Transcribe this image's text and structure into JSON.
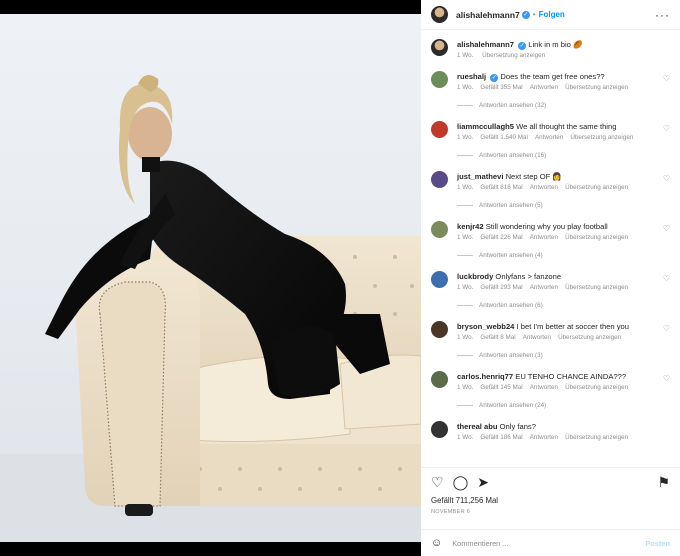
{
  "post": {
    "username": "alishalehmann7",
    "follow_label": "Folgen",
    "caption": "Link in m bio",
    "caption_time": "1 Wo.",
    "caption_translate": "Übersetzung anzeigen"
  },
  "comments": [
    {
      "user": "rueshalj",
      "verified": true,
      "text": "Does the team get free ones??",
      "time": "1 Wo.",
      "likes": "Gefällt 355 Mal",
      "reply": "Antworten",
      "translate": "Übersetzung anzeigen",
      "replies": "Antworten ansehen (32)",
      "color": "#6b8e5a"
    },
    {
      "user": "liammccullagh5",
      "verified": false,
      "text": "We all thought the same thing",
      "time": "1 Wo.",
      "likes": "Gefällt 1.540 Mal",
      "reply": "Antworten",
      "translate": "Übersetzung anzeigen",
      "replies": "Antworten ansehen (16)",
      "color": "#c0392b"
    },
    {
      "user": "just_mathevi",
      "verified": false,
      "text": "Next step OF 👩",
      "time": "1 Wo.",
      "likes": "Gefällt 818 Mal",
      "reply": "Antworten",
      "translate": "Übersetzung anzeigen",
      "replies": "Antworten ansehen (5)",
      "color": "#5b4a8a"
    },
    {
      "user": "kenjr42",
      "verified": false,
      "text": "Still wondering why you play football",
      "time": "1 Wo.",
      "likes": "Gefällt 226 Mal",
      "reply": "Antworten",
      "translate": "Übersetzung anzeigen",
      "replies": "Antworten ansehen (4)",
      "color": "#7a8c5c"
    },
    {
      "user": "luckbrody",
      "verified": false,
      "text": "Onlyfans > fanzone",
      "time": "1 Wo.",
      "likes": "Gefällt 293 Mal",
      "reply": "Antworten",
      "translate": "Übersetzung anzeigen",
      "replies": "Antworten ansehen (6)",
      "color": "#3d6fb0"
    },
    {
      "user": "bryson_webb24",
      "verified": false,
      "text": "I bet I'm better at soccer then you",
      "time": "1 Wo.",
      "likes": "Gefällt 8 Mal",
      "reply": "Antworten",
      "translate": "Übersetzung anzeigen",
      "replies": "Antworten ansehen (3)",
      "color": "#4a3728"
    },
    {
      "user": "carlos.henriq77",
      "verified": false,
      "text": "EU TENHO CHANCE AINDA???",
      "time": "1 Wo.",
      "likes": "Gefällt 145 Mal",
      "reply": "Antworten",
      "translate": "Übersetzung anzeigen",
      "replies": "Antworten ansehen (24)",
      "color": "#5c6b4a"
    },
    {
      "user": "thereal abu",
      "verified": false,
      "text": "Only fans?",
      "time": "1 Wo.",
      "likes": "Gefällt 186 Mal",
      "reply": "Antworten",
      "translate": "Übersetzung anzeigen",
      "replies": "",
      "color": "#333333"
    }
  ],
  "footer": {
    "likes": "Gefällt 711,256 Mal",
    "date": "NOVEMBER 6",
    "comment_placeholder": "Kommentieren ...",
    "post_label": "Posten"
  },
  "icons": {
    "like": "heart-icon",
    "comment": "comment-icon",
    "share": "share-icon",
    "save": "bookmark-icon",
    "more": "more-icon",
    "emoji": "emoji-icon"
  },
  "colors": {
    "accent": "#0095f6",
    "verified": "#3897f0"
  }
}
